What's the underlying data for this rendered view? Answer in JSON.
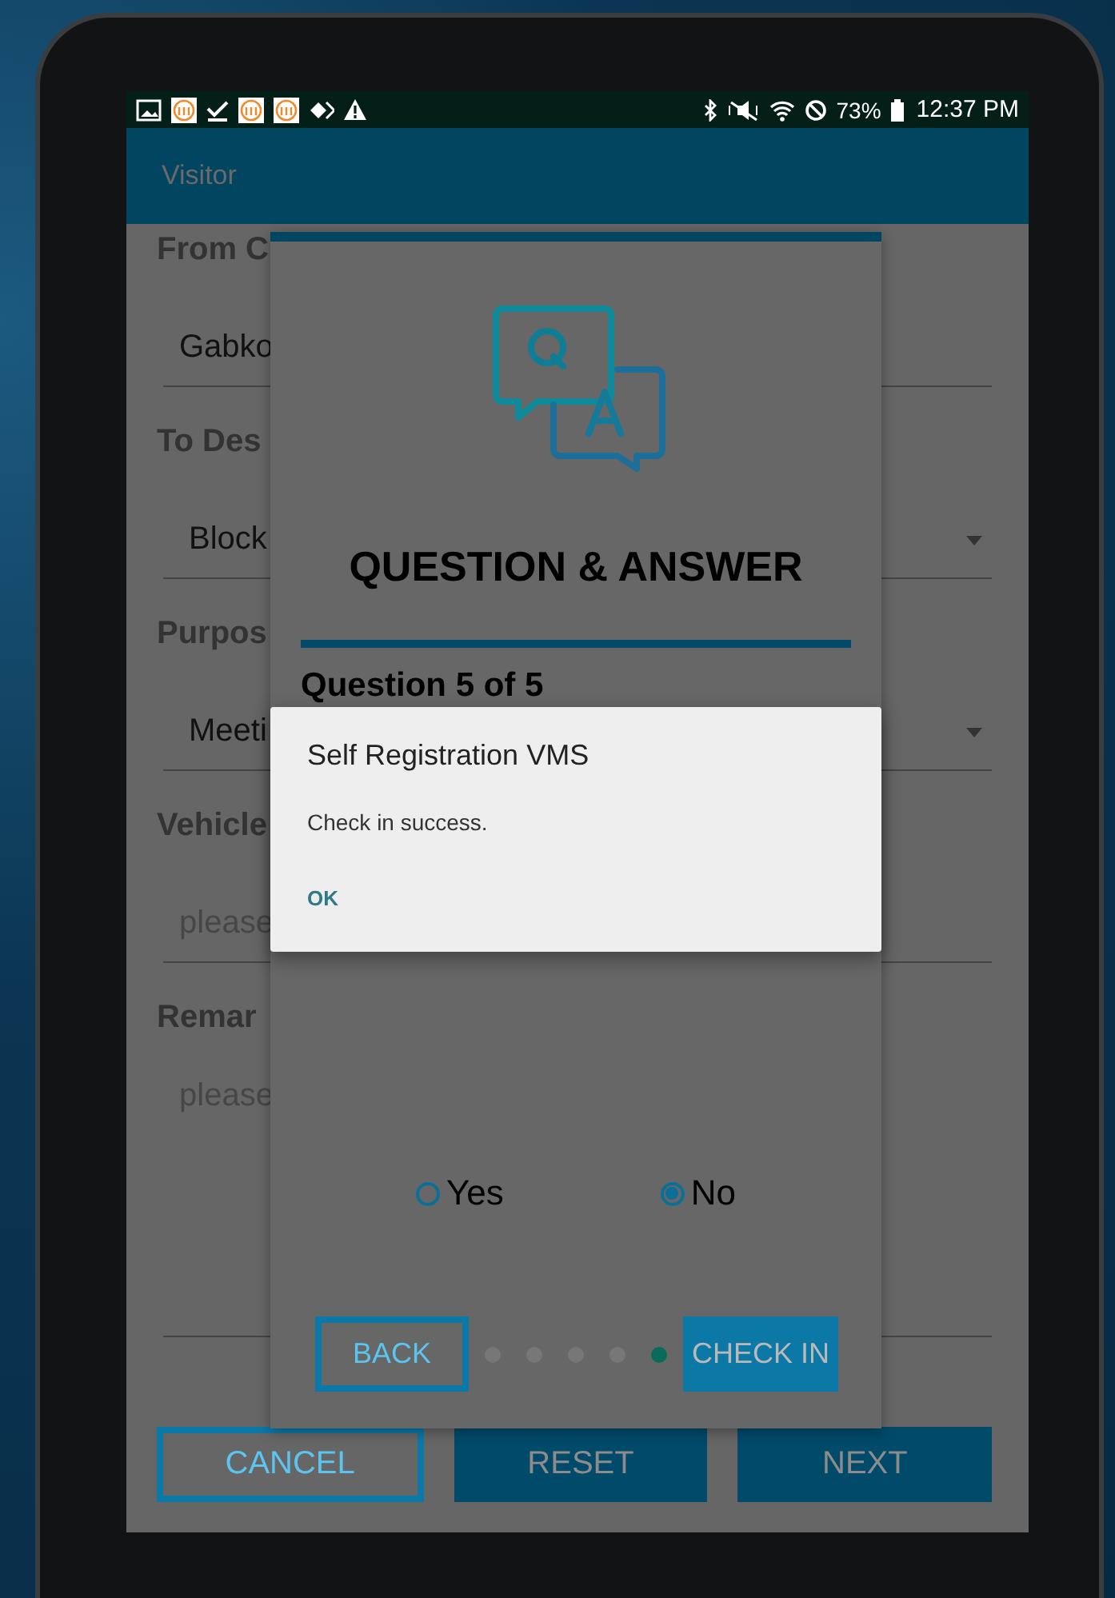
{
  "status_bar": {
    "battery": "73%",
    "time": "12:37 PM"
  },
  "app_bar": {
    "title": "Visitor"
  },
  "form": {
    "fields": [
      {
        "kind": "text",
        "label": "From C",
        "value": "Gabko"
      },
      {
        "kind": "dropdown",
        "label": "To Des",
        "value": "Block"
      },
      {
        "kind": "dropdown",
        "label": "Purpos",
        "value": "Meeti"
      },
      {
        "kind": "text",
        "label": "Vehicle",
        "placeholder": "please"
      },
      {
        "kind": "textarea",
        "label": "Remar",
        "placeholder": "please"
      }
    ],
    "buttons": [
      {
        "label": "CANCEL",
        "kind": "outline"
      },
      {
        "label": "RESET",
        "kind": "filled"
      },
      {
        "label": "NEXT",
        "kind": "filled"
      }
    ]
  },
  "qa_dialog": {
    "title": "QUESTION & ANSWER",
    "progress": "Question 5 of 5",
    "options": [
      {
        "label": "Yes",
        "selected": false
      },
      {
        "label": "No",
        "selected": true
      }
    ],
    "pages": [
      {
        "selected": false
      },
      {
        "selected": false
      },
      {
        "selected": false
      },
      {
        "selected": false
      },
      {
        "selected": true
      }
    ],
    "buttons": [
      {
        "label": "BACK",
        "kind": "outline"
      },
      {
        "label": "CHECK IN",
        "kind": "filled"
      }
    ]
  },
  "alert": {
    "title": "Self Registration VMS",
    "message": "Check in success.",
    "button": "OK"
  }
}
